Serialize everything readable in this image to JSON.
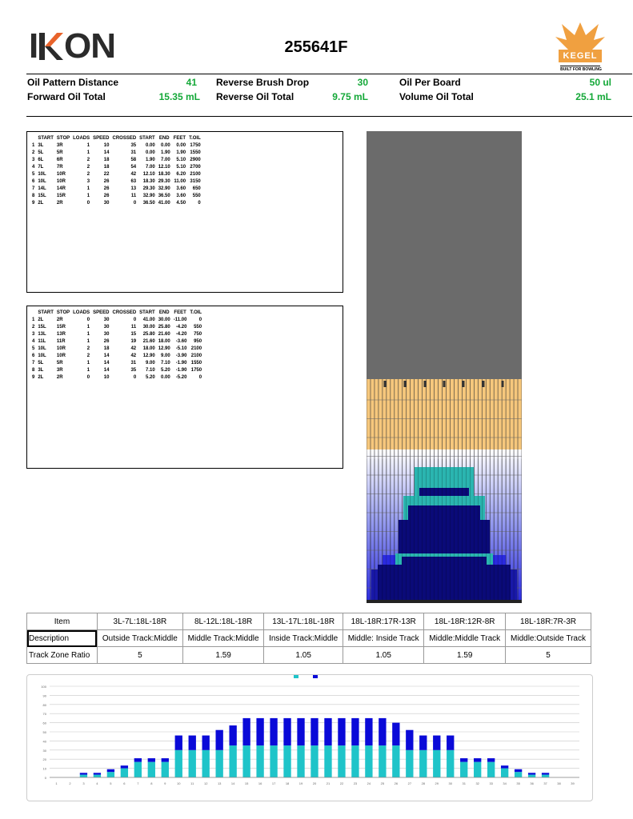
{
  "header": {
    "logo_text": "IKON",
    "pattern_name": "255641F",
    "kegel_text": "KEGEL",
    "kegel_tagline": "BUILT FOR BOWLING"
  },
  "stats": {
    "oil_pattern_distance_label": "Oil Pattern Distance",
    "oil_pattern_distance_value": "41",
    "reverse_brush_drop_label": "Reverse Brush Drop",
    "reverse_brush_drop_value": "30",
    "oil_per_board_label": "Oil Per Board",
    "oil_per_board_value": "50 ul",
    "forward_oil_total_label": "Forward Oil Total",
    "forward_oil_total_value": "15.35 mL",
    "reverse_oil_total_label": "Reverse Oil Total",
    "reverse_oil_total_value": "9.75 mL",
    "volume_oil_total_label": "Volume Oil Total",
    "volume_oil_total_value": "25.1 mL"
  },
  "columns": [
    "START",
    "STOP",
    "LOADS",
    "SPEED",
    "CROSSED",
    "START",
    "END",
    "FEET",
    "T.OIL"
  ],
  "forward_rows": [
    [
      "1",
      "3L",
      "3R",
      "1",
      "10",
      "35",
      "0.00",
      "0.00",
      "0.00",
      "1750"
    ],
    [
      "2",
      "5L",
      "5R",
      "1",
      "14",
      "31",
      "0.00",
      "1.90",
      "1.90",
      "1550"
    ],
    [
      "3",
      "6L",
      "6R",
      "2",
      "18",
      "58",
      "1.90",
      "7.00",
      "5.10",
      "2900"
    ],
    [
      "4",
      "7L",
      "7R",
      "2",
      "18",
      "54",
      "7.00",
      "12.10",
      "5.10",
      "2700"
    ],
    [
      "5",
      "10L",
      "10R",
      "2",
      "22",
      "42",
      "12.10",
      "18.30",
      "6.20",
      "2100"
    ],
    [
      "6",
      "10L",
      "10R",
      "3",
      "26",
      "63",
      "18.30",
      "29.30",
      "11.00",
      "3150"
    ],
    [
      "7",
      "14L",
      "14R",
      "1",
      "26",
      "13",
      "29.30",
      "32.90",
      "3.60",
      "650"
    ],
    [
      "8",
      "15L",
      "15R",
      "1",
      "26",
      "11",
      "32.90",
      "36.50",
      "3.60",
      "550"
    ],
    [
      "9",
      "2L",
      "2R",
      "0",
      "30",
      "0",
      "36.50",
      "41.00",
      "4.50",
      "0"
    ]
  ],
  "reverse_rows": [
    [
      "1",
      "2L",
      "2R",
      "0",
      "30",
      "0",
      "41.00",
      "30.00",
      "-11.00",
      "0"
    ],
    [
      "2",
      "15L",
      "15R",
      "1",
      "30",
      "11",
      "30.00",
      "25.80",
      "-4.20",
      "550"
    ],
    [
      "3",
      "13L",
      "13R",
      "1",
      "30",
      "15",
      "25.80",
      "21.60",
      "-4.20",
      "750"
    ],
    [
      "4",
      "11L",
      "11R",
      "1",
      "26",
      "19",
      "21.60",
      "18.00",
      "-3.60",
      "950"
    ],
    [
      "5",
      "10L",
      "10R",
      "2",
      "18",
      "42",
      "18.00",
      "12.90",
      "-5.10",
      "2100"
    ],
    [
      "6",
      "10L",
      "10R",
      "2",
      "14",
      "42",
      "12.90",
      "9.00",
      "-3.90",
      "2100"
    ],
    [
      "7",
      "5L",
      "5R",
      "1",
      "14",
      "31",
      "9.00",
      "7.10",
      "-1.90",
      "1550"
    ],
    [
      "8",
      "3L",
      "3R",
      "1",
      "14",
      "35",
      "7.10",
      "5.20",
      "-1.90",
      "1750"
    ],
    [
      "9",
      "2L",
      "2R",
      "0",
      "10",
      "0",
      "5.20",
      "0.00",
      "-5.20",
      "0"
    ]
  ],
  "track_zone": {
    "item_label": "Item",
    "description_label": "Description",
    "ratio_label": "Track Zone Ratio",
    "items": [
      "3L-7L:18L-18R",
      "8L-12L:18L-18R",
      "13L-17L:18L-18R",
      "18L-18R:17R-13R",
      "18L-18R:12R-8R",
      "18L-18R:7R-3R"
    ],
    "descriptions": [
      "Outside Track:Middle",
      "Middle Track:Middle",
      "Inside Track:Middle",
      "Middle: Inside Track",
      "Middle:Middle Track",
      "Middle:Outside Track"
    ],
    "ratios": [
      "5",
      "1.59",
      "1.05",
      "1.05",
      "1.59",
      "5"
    ]
  },
  "colors": {
    "green_value": "#14a838",
    "lane_dry": "#6b6b6b",
    "lane_wood": "#f6c77c",
    "bar_forward": "#1fc4c9",
    "bar_reverse": "#0a0ad8",
    "oil_dark": "#0a0a78",
    "oil_teal": "#2ab5b0"
  },
  "chart_data": {
    "type": "bar",
    "stacked": true,
    "categories": [
      "1",
      "2",
      "3",
      "4",
      "5",
      "6",
      "7",
      "8",
      "9",
      "10",
      "11",
      "12",
      "13",
      "14",
      "15",
      "16",
      "17",
      "18",
      "19",
      "20",
      "21",
      "22",
      "23",
      "24",
      "25",
      "26",
      "27",
      "28",
      "29",
      "30",
      "31",
      "32",
      "33",
      "34",
      "35",
      "36",
      "37",
      "38",
      "39"
    ],
    "series": [
      {
        "color": "#1fc4c9",
        "values": [
          0,
          0,
          3,
          3,
          6,
          10,
          17,
          17,
          17,
          30,
          30,
          30,
          30,
          35,
          35,
          35,
          35,
          35,
          35,
          35,
          35,
          35,
          35,
          35,
          35,
          35,
          30,
          30,
          30,
          30,
          17,
          17,
          17,
          10,
          6,
          3,
          3,
          0,
          0
        ]
      },
      {
        "color": "#0a0ad8",
        "values": [
          0,
          0,
          2,
          2,
          3,
          3,
          4,
          4,
          4,
          16,
          16,
          16,
          22,
          22,
          30,
          30,
          30,
          30,
          30,
          30,
          30,
          30,
          30,
          30,
          30,
          25,
          22,
          16,
          16,
          16,
          4,
          4,
          4,
          3,
          3,
          2,
          2,
          0,
          0
        ]
      }
    ],
    "ylim": [
      0,
      100
    ],
    "grid": true
  }
}
